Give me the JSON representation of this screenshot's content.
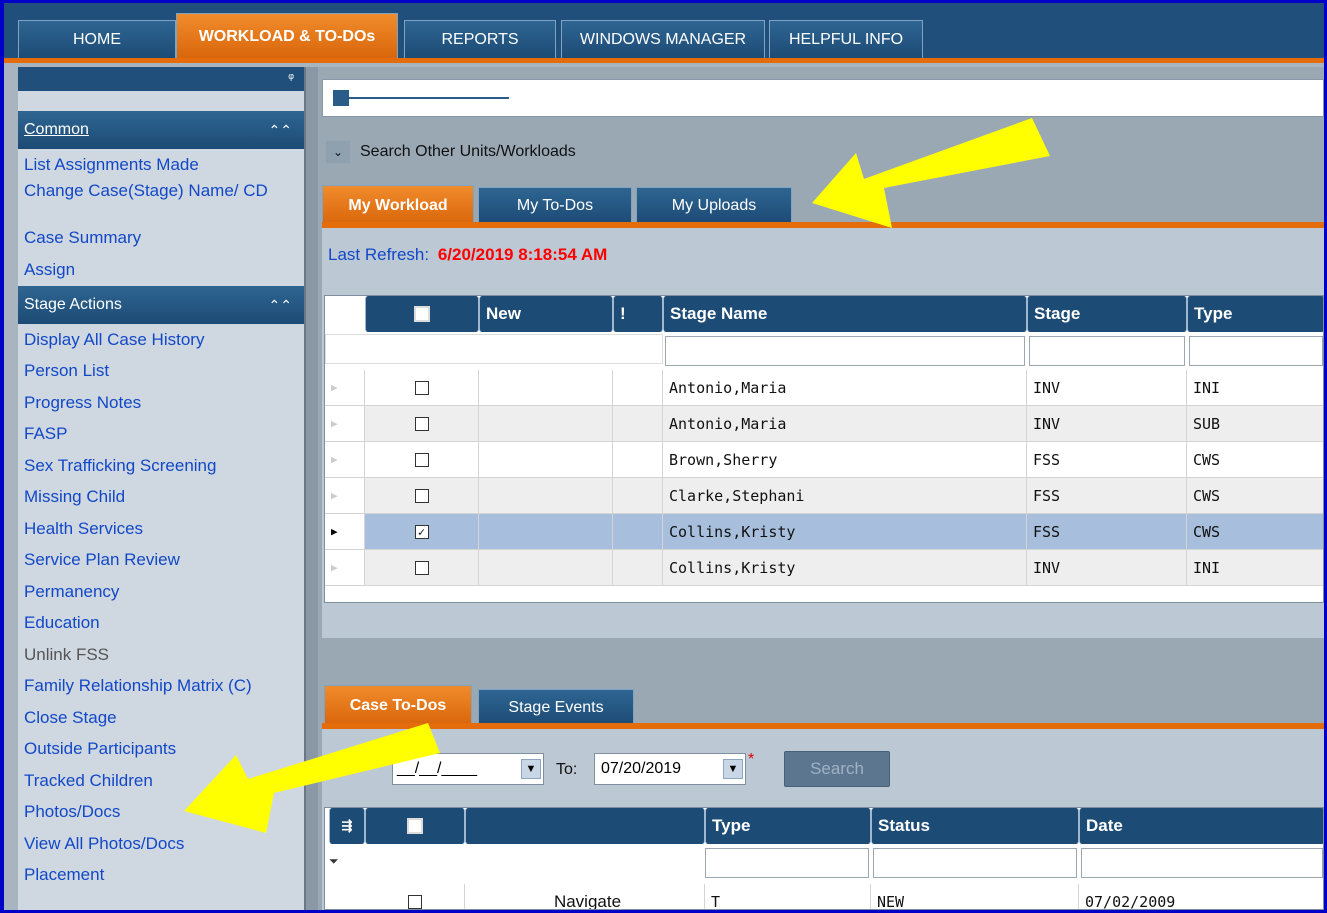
{
  "nav": {
    "tabs": [
      "HOME",
      "WORKLOAD & TO-DOs",
      "REPORTS",
      "WINDOWS MANAGER",
      "HELPFUL INFO"
    ],
    "active": 1
  },
  "sidebar": {
    "pin_icon": "pin-icon",
    "common": {
      "title": "Common",
      "items": [
        "List Assignments Made",
        "Change Case(Stage) Name/ CD",
        "Case Summary",
        "Assign"
      ]
    },
    "stage_actions": {
      "title": "Stage Actions",
      "items": [
        "Display All Case History",
        "Person List",
        "Progress Notes",
        "FASP",
        "Sex Trafficking Screening",
        "Missing Child",
        "Health Services",
        "Service Plan Review",
        "Permanency",
        "Education",
        "Unlink FSS",
        "Family Relationship Matrix (C)",
        "Close Stage",
        "Outside Participants",
        "Tracked Children",
        "Photos/Docs",
        "View All Photos/Docs",
        "Placement"
      ],
      "disabled": [
        "Unlink FSS"
      ]
    }
  },
  "main": {
    "search_other": "Search Other Units/Workloads",
    "workload_tabs": [
      "My Workload",
      "My To-Dos",
      "My Uploads"
    ],
    "last_refresh_label": "Last Refresh:",
    "last_refresh_value": "6/20/2019 8:18:54 AM",
    "workload_grid": {
      "columns": [
        "",
        "New",
        "!",
        "Stage Name",
        "Stage",
        "Type"
      ],
      "rows": [
        {
          "checked": false,
          "name": "Antonio,Maria",
          "stage": "INV",
          "type": "INI"
        },
        {
          "checked": false,
          "name": "Antonio,Maria",
          "stage": "INV",
          "type": "SUB"
        },
        {
          "checked": false,
          "name": "Brown,Sherry",
          "stage": "FSS",
          "type": "CWS"
        },
        {
          "checked": false,
          "name": "Clarke,Stephani",
          "stage": "FSS",
          "type": "CWS"
        },
        {
          "checked": true,
          "name": "Collins,Kristy",
          "stage": "FSS",
          "type": "CWS",
          "selected": true
        },
        {
          "checked": false,
          "name": "Collins,Kristy",
          "stage": "INV",
          "type": "INI"
        }
      ]
    },
    "case_tabs": [
      "Case To-Dos",
      "Stage Events"
    ],
    "date_from_value": "__/__/____",
    "to_label": "To:",
    "date_to_value": "07/20/2019",
    "search_button": "Search",
    "todo_grid": {
      "columns": [
        "",
        "",
        "Type",
        "Status",
        "Date"
      ],
      "rows": [
        {
          "checked": false,
          "action": "Navigate",
          "type": "T",
          "status": "NEW",
          "date": "07/02/2009"
        }
      ]
    }
  },
  "colors": {
    "accent": "#e46c0a",
    "nav": "#1f4f7a",
    "link": "#1248c8",
    "highlight_arrow": "#ffff00"
  }
}
